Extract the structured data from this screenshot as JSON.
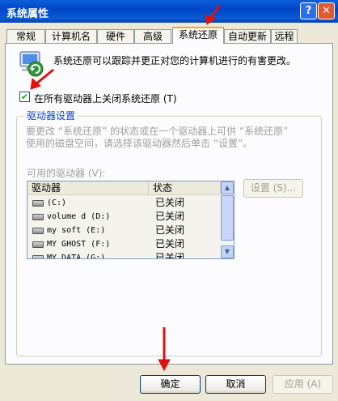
{
  "window": {
    "title": "系统属性",
    "help_glyph": "?",
    "close_glyph": "✕"
  },
  "tabs": [
    {
      "label": "常规"
    },
    {
      "label": "计算机名"
    },
    {
      "label": "硬件"
    },
    {
      "label": "高级"
    },
    {
      "label": "系统还原"
    },
    {
      "label": "自动更新"
    },
    {
      "label": "远程"
    }
  ],
  "active_tab": "系统还原",
  "panel": {
    "intro_text": "系统还原可以跟踪并更正对您的计算机进行的有害更改。",
    "turn_off_checkbox": {
      "label": "在所有驱动器上关闭系统还原 (T)",
      "checked": true,
      "check_glyph": "✔"
    },
    "group": {
      "legend": "驱动器设置",
      "description_line1": "要更改 “系统还原” 的状态或在一个驱动器上可供 “系统还原”",
      "description_line2": "使用的磁盘空间，请选择该驱动器然后单击 “设置”。",
      "available_label": "可用的驱动器 (V):",
      "columns": {
        "drive": "驱动器",
        "status": "状态"
      },
      "drives": [
        {
          "name": "(C:)",
          "status": "已关闭"
        },
        {
          "name": "volume d (D:)",
          "status": "已关闭"
        },
        {
          "name": "my soft (E:)",
          "status": "已关闭"
        },
        {
          "name": "MY GHOST (F:)",
          "status": "已关闭"
        },
        {
          "name": "MY DATA (G:)",
          "status": "已关闭"
        }
      ],
      "settings_button": "设置 (S)..."
    }
  },
  "buttons": {
    "ok": "确定",
    "cancel": "取消",
    "apply": "应用 (A)"
  },
  "colors": {
    "title_bar": "#0a5fd8",
    "dialog_bg": "#ece9d8",
    "accent": "#0046d5",
    "annotation_arrow": "#e01010",
    "check": "#21a121"
  },
  "icons": [
    "system-restore-icon",
    "help-icon",
    "close-icon",
    "drive-icon",
    "red-arrow-annotation"
  ]
}
